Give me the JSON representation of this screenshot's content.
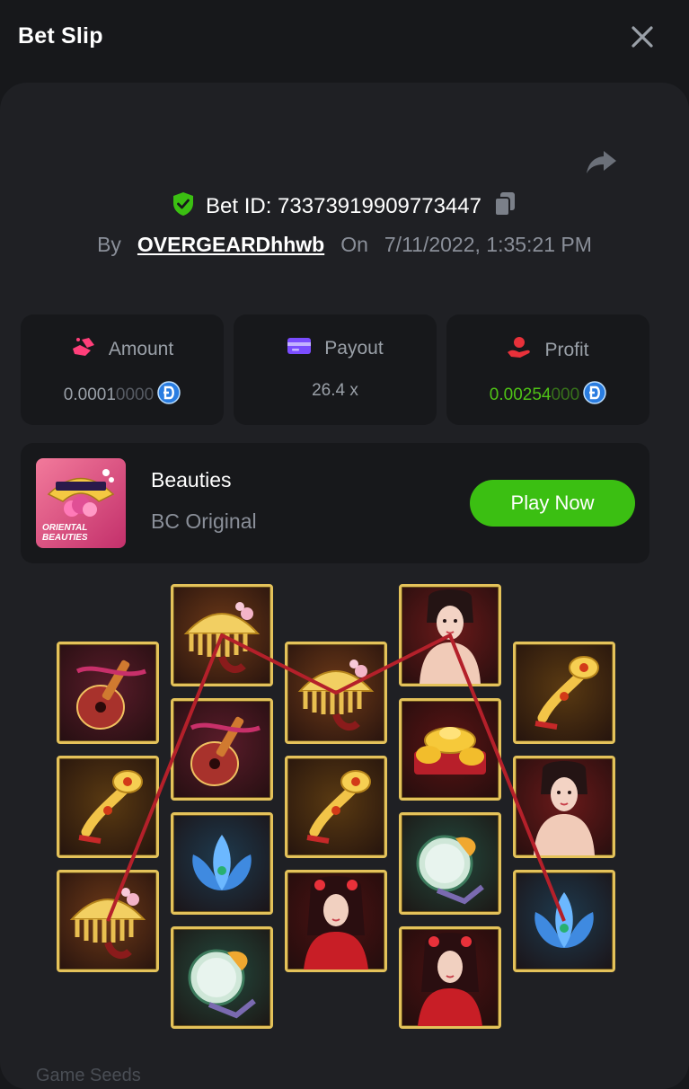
{
  "header": {
    "title": "Bet Slip"
  },
  "bet": {
    "id_label": "Bet ID: 73373919909773447",
    "by_label": "By",
    "username": "OVERGEARDhhwb",
    "on_label": "On",
    "date": "7/11/2022, 1:35:21 PM"
  },
  "stats": {
    "amount": {
      "label": "Amount",
      "value_main": "0.0001",
      "value_dim": "0000"
    },
    "payout": {
      "label": "Payout",
      "value": "26.4 x"
    },
    "profit": {
      "label": "Profit",
      "value_main": "0.00254",
      "value_dim": "000"
    }
  },
  "game": {
    "name": "Beauties",
    "provider": "BC Original",
    "play_label": "Play Now",
    "thumb_text_line1": "ORIENTAL",
    "thumb_text_line2": "BEAUTIES"
  },
  "reels": [
    [
      "pipa",
      "ruyi",
      "comb"
    ],
    [
      "comb",
      "pipa",
      "lotus",
      "fan"
    ],
    [
      "comb",
      "ruyi",
      "lady"
    ],
    [
      "beauty",
      "gold",
      "fan",
      "lady"
    ],
    [
      "ruyi",
      "beauty",
      "lotus"
    ]
  ],
  "payline_symbols": [
    "comb",
    "comb",
    "comb",
    "beauty",
    "lotus"
  ],
  "colors": {
    "accent_green": "#3bbf12",
    "profit_green": "#4fc216",
    "tile_border": "#e4c25a"
  },
  "footer": {
    "text": "Game Seeds"
  }
}
